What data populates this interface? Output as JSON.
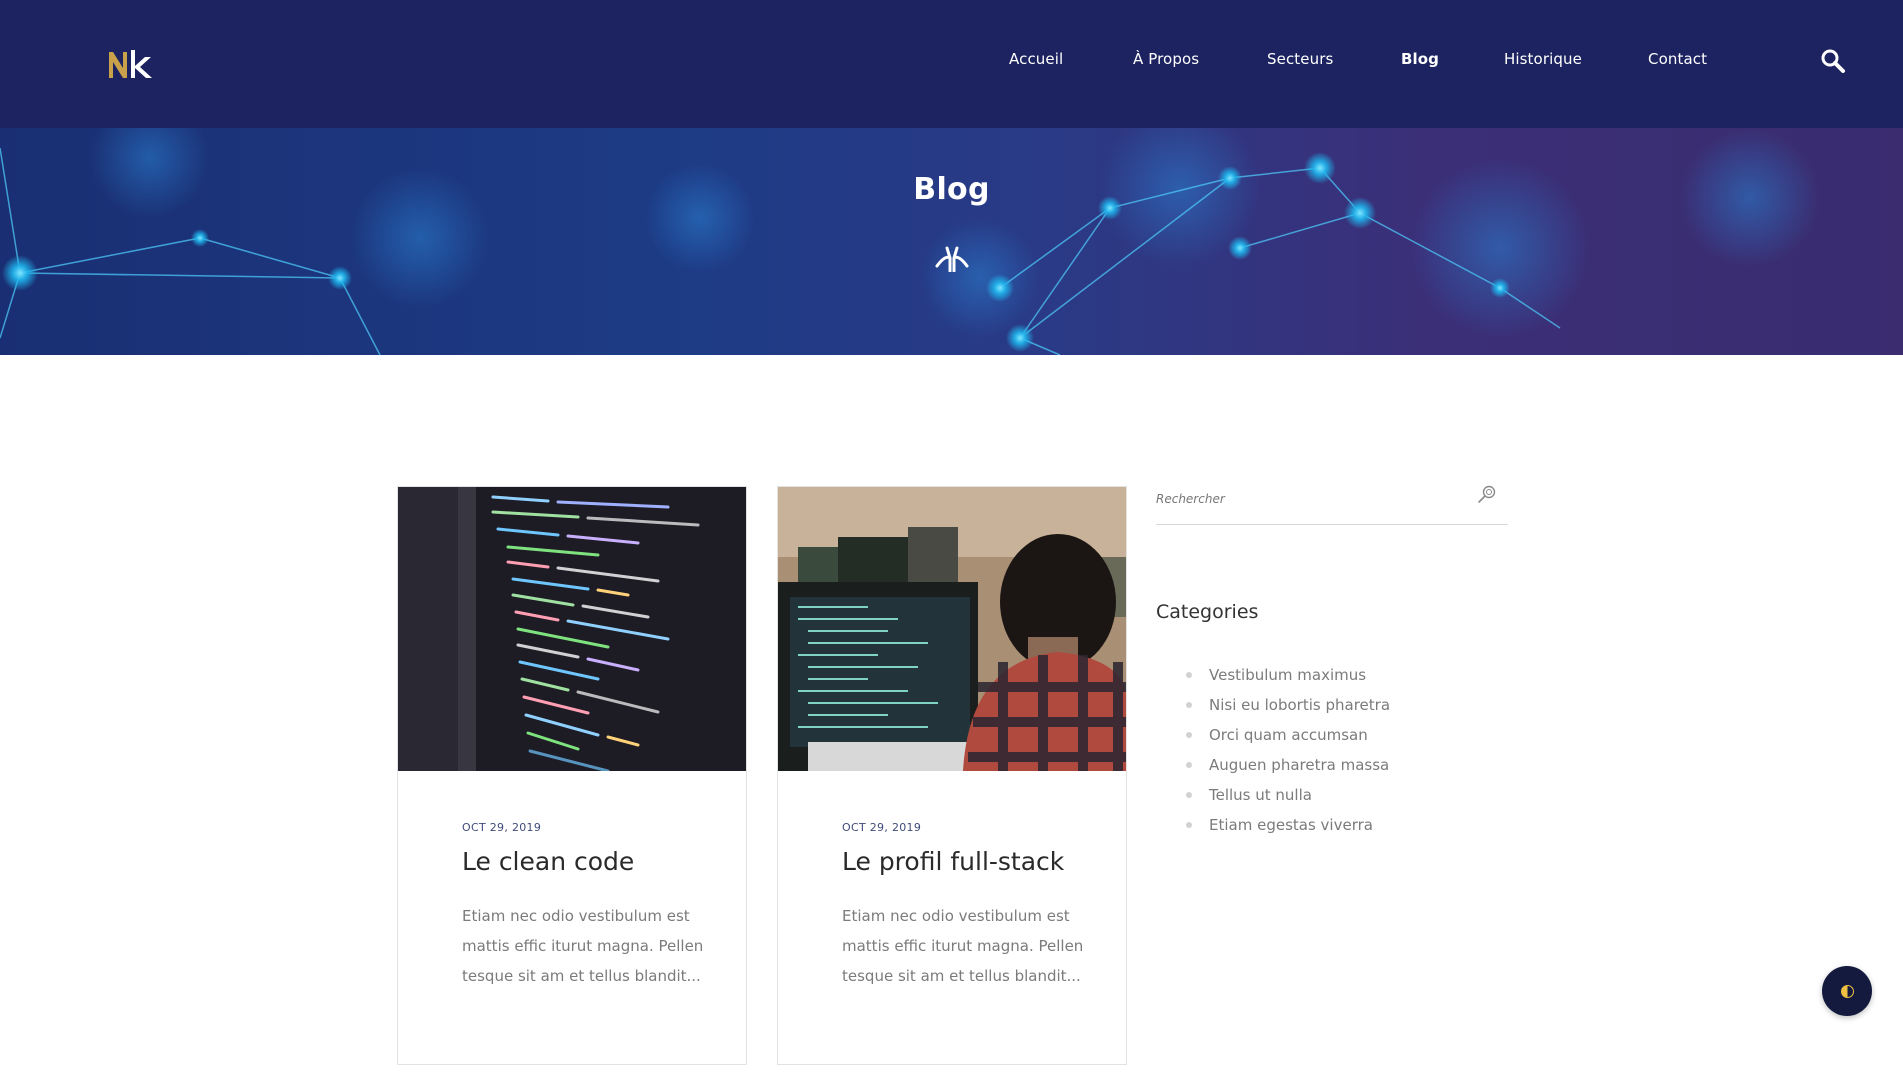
{
  "brand": {
    "logo": "Nk",
    "logo_accent": "#c9a14a"
  },
  "nav": {
    "items": [
      {
        "label": "Accueil"
      },
      {
        "label": "À Propos"
      },
      {
        "label": "Secteurs"
      },
      {
        "label": "Blog",
        "active": true
      },
      {
        "label": "Historique"
      },
      {
        "label": "Contact"
      }
    ],
    "search_icon": "search-icon"
  },
  "hero": {
    "title": "Blog",
    "mark_icon": "brand-mark-icon"
  },
  "posts": [
    {
      "date": "OCT 29, 2019",
      "title": "Le clean code",
      "excerpt": "Etiam nec odio vestibulum est mattis effic iturut magna. Pellen tesque sit am et tellus blandit...",
      "image": "code-on-screen"
    },
    {
      "date": "OCT 29, 2019",
      "title": "Le profil full-stack",
      "excerpt": "Etiam nec odio vestibulum est mattis effic iturut magna. Pellen tesque sit am et tellus blandit...",
      "image": "developer-at-computer"
    }
  ],
  "sidebar": {
    "search_placeholder": "Rechercher",
    "categories_heading": "Categories",
    "categories": [
      "Vestibulum maximus",
      "Nisi eu lobortis pharetra",
      "Orci quam accumsan",
      "Auguen pharetra massa",
      "Tellus ut nulla",
      "Etiam egestas viverra"
    ]
  },
  "colors": {
    "header_bg": "#1c2360",
    "date_color": "#3f4b7a",
    "float_button": "#131a3e"
  }
}
